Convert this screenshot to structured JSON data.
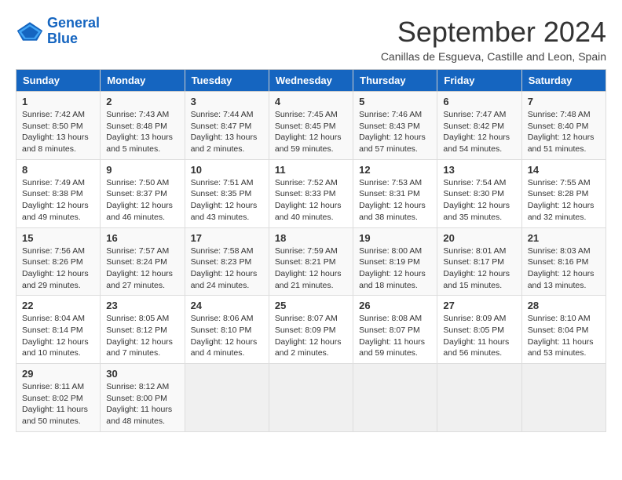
{
  "logo": {
    "line1": "General",
    "line2": "Blue"
  },
  "title": "September 2024",
  "location": "Canillas de Esgueva, Castille and Leon, Spain",
  "headers": [
    "Sunday",
    "Monday",
    "Tuesday",
    "Wednesday",
    "Thursday",
    "Friday",
    "Saturday"
  ],
  "weeks": [
    [
      {
        "day": "1",
        "info": "Sunrise: 7:42 AM\nSunset: 8:50 PM\nDaylight: 13 hours\nand 8 minutes."
      },
      {
        "day": "2",
        "info": "Sunrise: 7:43 AM\nSunset: 8:48 PM\nDaylight: 13 hours\nand 5 minutes."
      },
      {
        "day": "3",
        "info": "Sunrise: 7:44 AM\nSunset: 8:47 PM\nDaylight: 13 hours\nand 2 minutes."
      },
      {
        "day": "4",
        "info": "Sunrise: 7:45 AM\nSunset: 8:45 PM\nDaylight: 12 hours\nand 59 minutes."
      },
      {
        "day": "5",
        "info": "Sunrise: 7:46 AM\nSunset: 8:43 PM\nDaylight: 12 hours\nand 57 minutes."
      },
      {
        "day": "6",
        "info": "Sunrise: 7:47 AM\nSunset: 8:42 PM\nDaylight: 12 hours\nand 54 minutes."
      },
      {
        "day": "7",
        "info": "Sunrise: 7:48 AM\nSunset: 8:40 PM\nDaylight: 12 hours\nand 51 minutes."
      }
    ],
    [
      {
        "day": "8",
        "info": "Sunrise: 7:49 AM\nSunset: 8:38 PM\nDaylight: 12 hours\nand 49 minutes."
      },
      {
        "day": "9",
        "info": "Sunrise: 7:50 AM\nSunset: 8:37 PM\nDaylight: 12 hours\nand 46 minutes."
      },
      {
        "day": "10",
        "info": "Sunrise: 7:51 AM\nSunset: 8:35 PM\nDaylight: 12 hours\nand 43 minutes."
      },
      {
        "day": "11",
        "info": "Sunrise: 7:52 AM\nSunset: 8:33 PM\nDaylight: 12 hours\nand 40 minutes."
      },
      {
        "day": "12",
        "info": "Sunrise: 7:53 AM\nSunset: 8:31 PM\nDaylight: 12 hours\nand 38 minutes."
      },
      {
        "day": "13",
        "info": "Sunrise: 7:54 AM\nSunset: 8:30 PM\nDaylight: 12 hours\nand 35 minutes."
      },
      {
        "day": "14",
        "info": "Sunrise: 7:55 AM\nSunset: 8:28 PM\nDaylight: 12 hours\nand 32 minutes."
      }
    ],
    [
      {
        "day": "15",
        "info": "Sunrise: 7:56 AM\nSunset: 8:26 PM\nDaylight: 12 hours\nand 29 minutes."
      },
      {
        "day": "16",
        "info": "Sunrise: 7:57 AM\nSunset: 8:24 PM\nDaylight: 12 hours\nand 27 minutes."
      },
      {
        "day": "17",
        "info": "Sunrise: 7:58 AM\nSunset: 8:23 PM\nDaylight: 12 hours\nand 24 minutes."
      },
      {
        "day": "18",
        "info": "Sunrise: 7:59 AM\nSunset: 8:21 PM\nDaylight: 12 hours\nand 21 minutes."
      },
      {
        "day": "19",
        "info": "Sunrise: 8:00 AM\nSunset: 8:19 PM\nDaylight: 12 hours\nand 18 minutes."
      },
      {
        "day": "20",
        "info": "Sunrise: 8:01 AM\nSunset: 8:17 PM\nDaylight: 12 hours\nand 15 minutes."
      },
      {
        "day": "21",
        "info": "Sunrise: 8:03 AM\nSunset: 8:16 PM\nDaylight: 12 hours\nand 13 minutes."
      }
    ],
    [
      {
        "day": "22",
        "info": "Sunrise: 8:04 AM\nSunset: 8:14 PM\nDaylight: 12 hours\nand 10 minutes."
      },
      {
        "day": "23",
        "info": "Sunrise: 8:05 AM\nSunset: 8:12 PM\nDaylight: 12 hours\nand 7 minutes."
      },
      {
        "day": "24",
        "info": "Sunrise: 8:06 AM\nSunset: 8:10 PM\nDaylight: 12 hours\nand 4 minutes."
      },
      {
        "day": "25",
        "info": "Sunrise: 8:07 AM\nSunset: 8:09 PM\nDaylight: 12 hours\nand 2 minutes."
      },
      {
        "day": "26",
        "info": "Sunrise: 8:08 AM\nSunset: 8:07 PM\nDaylight: 11 hours\nand 59 minutes."
      },
      {
        "day": "27",
        "info": "Sunrise: 8:09 AM\nSunset: 8:05 PM\nDaylight: 11 hours\nand 56 minutes."
      },
      {
        "day": "28",
        "info": "Sunrise: 8:10 AM\nSunset: 8:04 PM\nDaylight: 11 hours\nand 53 minutes."
      }
    ],
    [
      {
        "day": "29",
        "info": "Sunrise: 8:11 AM\nSunset: 8:02 PM\nDaylight: 11 hours\nand 50 minutes."
      },
      {
        "day": "30",
        "info": "Sunrise: 8:12 AM\nSunset: 8:00 PM\nDaylight: 11 hours\nand 48 minutes."
      },
      {
        "day": "",
        "info": ""
      },
      {
        "day": "",
        "info": ""
      },
      {
        "day": "",
        "info": ""
      },
      {
        "day": "",
        "info": ""
      },
      {
        "day": "",
        "info": ""
      }
    ]
  ]
}
